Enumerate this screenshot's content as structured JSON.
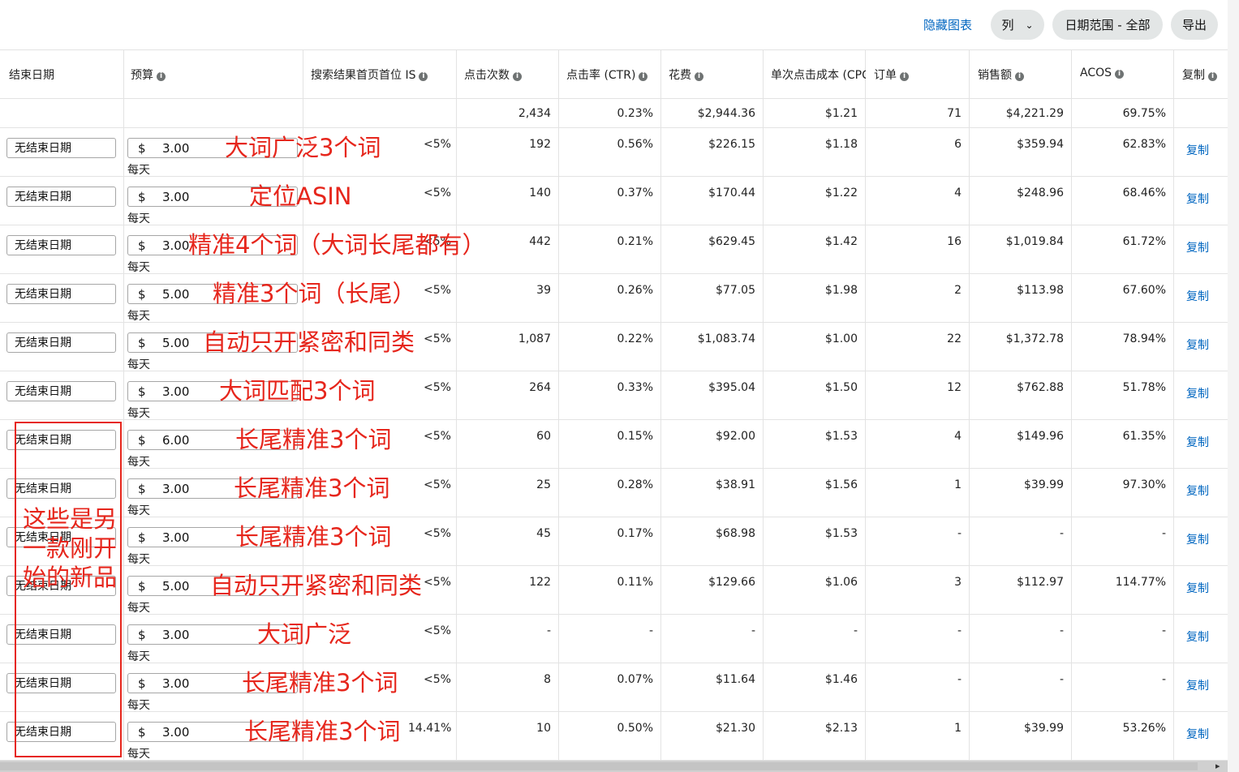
{
  "toolbar": {
    "hide_chart": "隐藏图表",
    "columns": "列",
    "date_range": "日期范围 - 全部",
    "export": "导出"
  },
  "headers": {
    "end_date": "结束日期",
    "budget": "预算",
    "top_is": "搜索结果首页首位 IS",
    "clicks": "点击次数",
    "ctr": "点击率 (CTR)",
    "spend": "花费",
    "cpc": "单次点击成本 (CPC",
    "orders": "订单",
    "sales": "销售额",
    "acos": "ACOS",
    "copy": "复制"
  },
  "totals": {
    "clicks": "2,434",
    "ctr": "0.23%",
    "spend": "$2,944.36",
    "cpc": "$1.21",
    "orders": "71",
    "sales": "$4,221.29",
    "acos": "69.75%"
  },
  "currency": "$",
  "per_day": "每天",
  "end_date_value": "无结束日期",
  "copy_label": "复制",
  "rows": [
    {
      "budget": "3.00",
      "is": "<5%",
      "clicks": "192",
      "ctr": "0.56%",
      "spend": "$226.15",
      "cpc": "$1.18",
      "orders": "6",
      "sales": "$359.94",
      "acos": "62.83%",
      "note": "大词广泛3个词"
    },
    {
      "budget": "3.00",
      "is": "<5%",
      "clicks": "140",
      "ctr": "0.37%",
      "spend": "$170.44",
      "cpc": "$1.22",
      "orders": "4",
      "sales": "$248.96",
      "acos": "68.46%",
      "note": "定位ASIN"
    },
    {
      "budget": "3.00",
      "is": "<5%",
      "clicks": "442",
      "ctr": "0.21%",
      "spend": "$629.45",
      "cpc": "$1.42",
      "orders": "16",
      "sales": "$1,019.84",
      "acos": "61.72%",
      "note": "精准4个词（大词长尾都有）"
    },
    {
      "budget": "5.00",
      "is": "<5%",
      "clicks": "39",
      "ctr": "0.26%",
      "spend": "$77.05",
      "cpc": "$1.98",
      "orders": "2",
      "sales": "$113.98",
      "acos": "67.60%",
      "note": "精准3个词（长尾）"
    },
    {
      "budget": "5.00",
      "is": "<5%",
      "clicks": "1,087",
      "ctr": "0.22%",
      "spend": "$1,083.74",
      "cpc": "$1.00",
      "orders": "22",
      "sales": "$1,372.78",
      "acos": "78.94%",
      "note": "自动只开紧密和同类"
    },
    {
      "budget": "3.00",
      "is": "<5%",
      "clicks": "264",
      "ctr": "0.33%",
      "spend": "$395.04",
      "cpc": "$1.50",
      "orders": "12",
      "sales": "$762.88",
      "acos": "51.78%",
      "note": "大词匹配3个词"
    },
    {
      "budget": "6.00",
      "is": "<5%",
      "clicks": "60",
      "ctr": "0.15%",
      "spend": "$92.00",
      "cpc": "$1.53",
      "orders": "4",
      "sales": "$149.96",
      "acos": "61.35%",
      "note": "长尾精准3个词"
    },
    {
      "budget": "3.00",
      "is": "<5%",
      "clicks": "25",
      "ctr": "0.28%",
      "spend": "$38.91",
      "cpc": "$1.56",
      "orders": "1",
      "sales": "$39.99",
      "acos": "97.30%",
      "note": "长尾精准3个词"
    },
    {
      "budget": "3.00",
      "is": "<5%",
      "clicks": "45",
      "ctr": "0.17%",
      "spend": "$68.98",
      "cpc": "$1.53",
      "orders": "-",
      "sales": "-",
      "acos": "-",
      "note": "长尾精准3个词"
    },
    {
      "budget": "5.00",
      "is": "<5%",
      "clicks": "122",
      "ctr": "0.11%",
      "spend": "$129.66",
      "cpc": "$1.06",
      "orders": "3",
      "sales": "$112.97",
      "acos": "114.77%",
      "note": "自动只开紧密和同类"
    },
    {
      "budget": "3.00",
      "is": "<5%",
      "clicks": "-",
      "ctr": "-",
      "spend": "-",
      "cpc": "-",
      "orders": "-",
      "sales": "-",
      "acos": "-",
      "note": "大词广泛"
    },
    {
      "budget": "3.00",
      "is": "<5%",
      "clicks": "8",
      "ctr": "0.07%",
      "spend": "$11.64",
      "cpc": "$1.46",
      "orders": "-",
      "sales": "-",
      "acos": "-",
      "note": "长尾精准3个词"
    },
    {
      "budget": "3.00",
      "is": "14.41%",
      "clicks": "10",
      "ctr": "0.50%",
      "spend": "$21.30",
      "cpc": "$2.13",
      "orders": "1",
      "sales": "$39.99",
      "acos": "53.26%",
      "note": "长尾精准3个词"
    }
  ],
  "box_note": "这些是另一款刚开始的新品"
}
